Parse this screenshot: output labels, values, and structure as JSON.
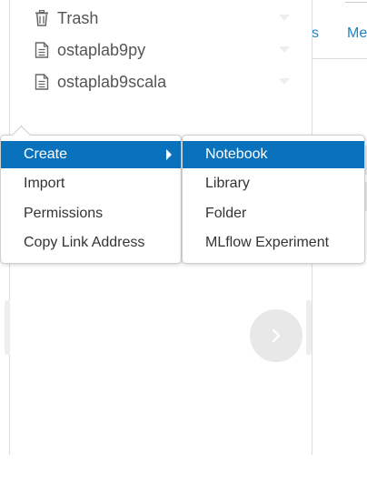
{
  "sidebar": {
    "items": [
      {
        "label": "Trash",
        "icon": "trash-icon"
      },
      {
        "label": "ostaplab9py",
        "icon": "file-icon"
      },
      {
        "label": "ostaplab9scala",
        "icon": "file-icon"
      }
    ]
  },
  "background": {
    "tabs": [
      "s",
      "Me"
    ]
  },
  "context_menu": {
    "items": [
      "Create",
      "Import",
      "Permissions",
      "Copy Link Address"
    ],
    "active": "Create"
  },
  "create_submenu": {
    "items": [
      "Notebook",
      "Library",
      "Folder",
      "MLflow Experiment"
    ],
    "active": "Notebook"
  },
  "colors": {
    "accent": "#0a72bc",
    "link": "#1b84c8",
    "text": "#333333",
    "muted_text": "#555555"
  },
  "icons": {
    "next": "chevron-right-icon",
    "submenu": "caret-right-icon"
  }
}
